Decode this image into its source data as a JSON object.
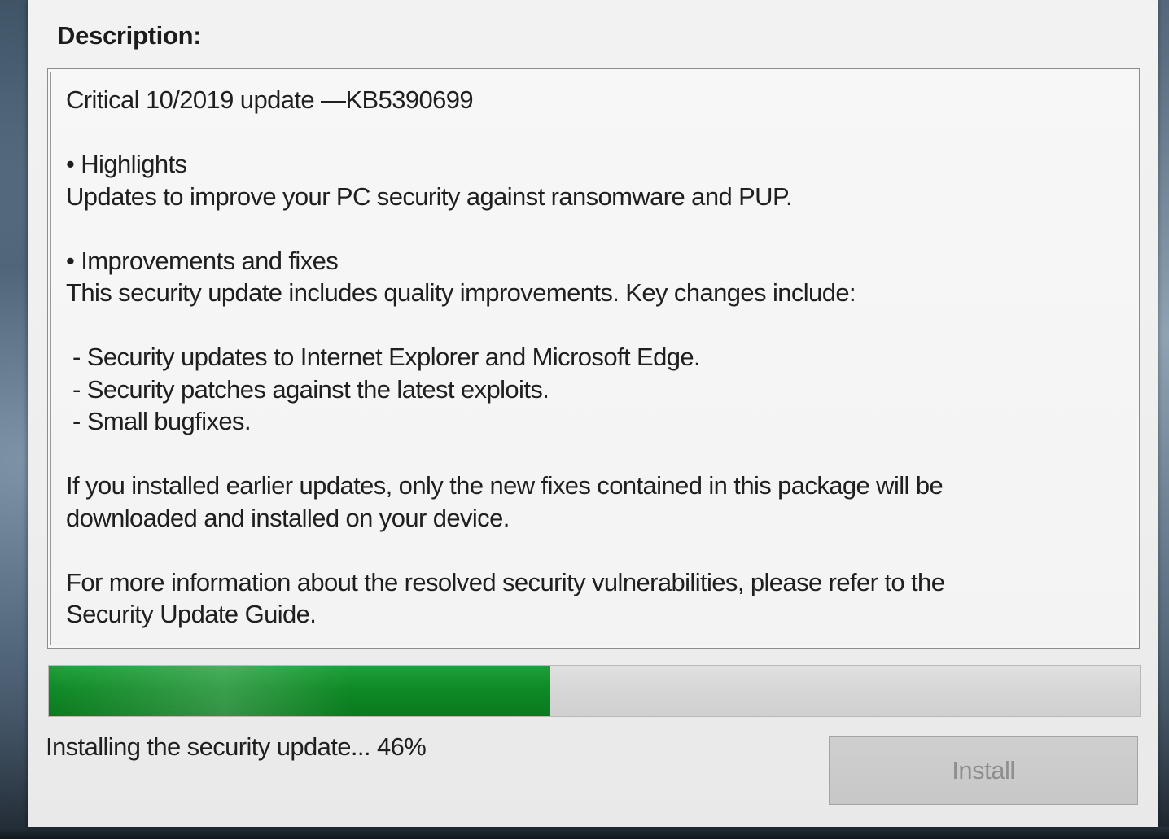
{
  "dialog": {
    "description_label": "Description:",
    "description_lines": [
      "Critical 10/2019 update —KB5390699",
      "",
      "• Highlights",
      "Updates to improve your PC security against ransomware and PUP.",
      "",
      "• Improvements and fixes",
      "This security update includes quality improvements. Key changes include:",
      "",
      " - Security updates to Internet Explorer and Microsoft Edge.",
      " - Security patches against the latest exploits.",
      " - Small bugfixes.",
      "",
      "If you installed earlier updates, only the new fixes contained in this package will be",
      "downloaded and installed on your device.",
      "",
      "For more information about the resolved security vulnerabilities, please refer to the",
      "Security Update Guide."
    ],
    "progress": {
      "percent": 46,
      "fill_color": "#0f8a26"
    },
    "status_text": "Installing the security update... 46%",
    "install_button": {
      "label": "Install",
      "disabled": true
    }
  }
}
